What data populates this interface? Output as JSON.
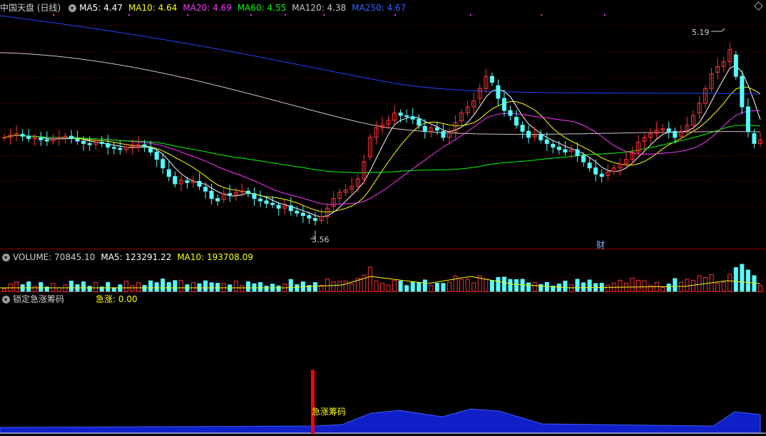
{
  "main": {
    "title": "中国天盘 (日线)",
    "ma": [
      {
        "label": "MA5: 4.47",
        "color": "#ffffff"
      },
      {
        "label": "MA10: 4.64",
        "color": "#ffff00"
      },
      {
        "label": "MA20: 4.69",
        "color": "#ff33ff"
      },
      {
        "label": "MA60: 4.55",
        "color": "#00ff00"
      },
      {
        "label": "MA120: 4.38",
        "color": "#c8c8c8"
      },
      {
        "label": "MA250: 4.67",
        "color": "#3366ff"
      }
    ],
    "high_label": "5.19",
    "low_label": "3.56",
    "event_label": "财"
  },
  "volume": {
    "label": "VOLUME: 70845.10",
    "ma5": "MA5: 123291.22",
    "ma10": "MA10: 193708.09"
  },
  "indicator": {
    "title": "锁定急涨筹码",
    "value": "急涨: 0.00",
    "signal_label": "急涨筹码"
  },
  "chart_data": {
    "type": "candlestick",
    "closes": [
      4.3,
      4.32,
      4.33,
      4.31,
      4.29,
      4.3,
      4.28,
      4.27,
      4.29,
      4.3,
      4.31,
      4.29,
      4.27,
      4.25,
      4.24,
      4.26,
      4.25,
      4.22,
      4.21,
      4.2,
      4.22,
      4.23,
      4.24,
      4.22,
      4.18,
      4.12,
      4.05,
      3.98,
      3.92,
      3.95,
      3.93,
      3.94,
      3.9,
      3.86,
      3.8,
      3.78,
      3.84,
      3.83,
      3.85,
      3.86,
      3.84,
      3.8,
      3.78,
      3.76,
      3.75,
      3.72,
      3.74,
      3.7,
      3.68,
      3.66,
      3.64,
      3.62,
      3.65,
      3.72,
      3.8,
      3.85,
      3.87,
      3.9,
      3.96,
      4.1,
      4.3,
      4.38,
      4.4,
      4.44,
      4.5,
      4.48,
      4.47,
      4.45,
      4.4,
      4.35,
      4.38,
      4.36,
      4.3,
      4.34,
      4.42,
      4.5,
      4.55,
      4.6,
      4.7,
      4.8,
      4.75,
      4.62,
      4.52,
      4.48,
      4.4,
      4.35,
      4.3,
      4.32,
      4.28,
      4.25,
      4.22,
      4.2,
      4.18,
      4.2,
      4.15,
      4.1,
      4.05,
      4.0,
      3.98,
      4.02,
      4.05,
      4.08,
      4.12,
      4.18,
      4.26,
      4.3,
      4.33,
      4.36,
      4.37,
      4.35,
      4.3,
      4.35,
      4.4,
      4.48,
      4.58,
      4.7,
      4.82,
      4.88,
      4.92,
      5.02,
      4.8,
      4.55,
      4.35,
      4.25,
      4.28
    ]
  }
}
